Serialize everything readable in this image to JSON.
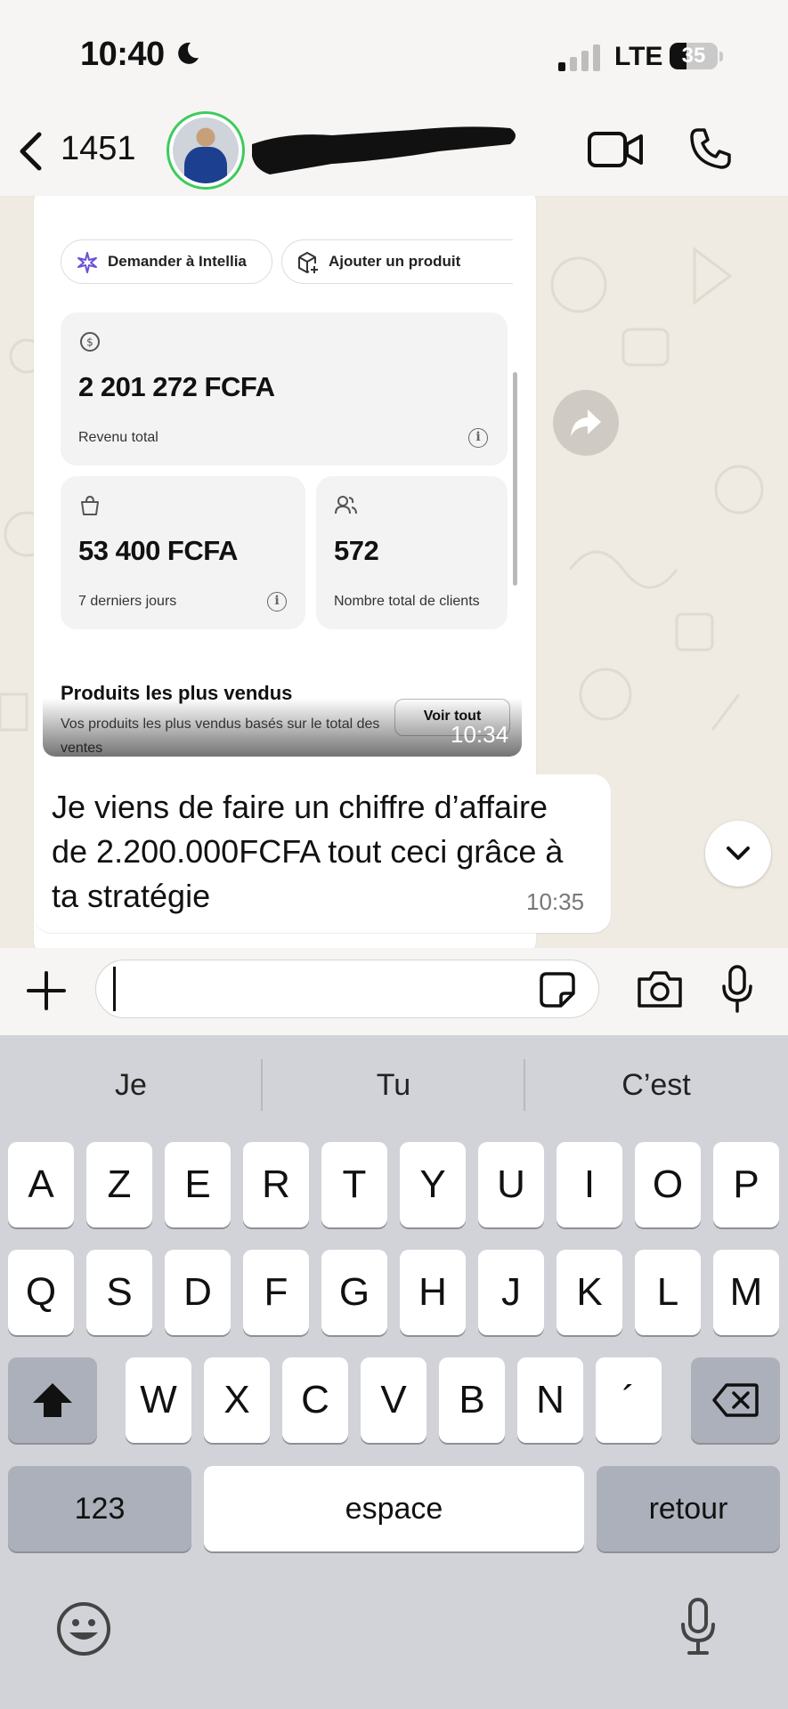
{
  "status": {
    "time": "10:40",
    "network": "LTE",
    "battery": "35",
    "battery_level": 0.35
  },
  "header": {
    "back_count": "1451"
  },
  "shared_screenshot": {
    "action_ask": "Demander à Intellia",
    "action_add": "Ajouter un produit",
    "total_revenue": {
      "value": "2 201 272 FCFA",
      "label": "Revenu total"
    },
    "last7": {
      "value": "53 400 FCFA",
      "label": "7 derniers jours"
    },
    "clients": {
      "value": "572",
      "label": "Nombre total de clients"
    },
    "products_title": "Produits les plus vendus",
    "products_subtitle": "Vos produits les plus vendus basés sur le total des ventes",
    "see_all": "Voir tout",
    "time": "10:34"
  },
  "message": {
    "text": "Je viens de faire un chiffre d’affaire de 2.200.000FCFA tout ceci grâce à ta stratégie",
    "time": "10:35"
  },
  "keyboard": {
    "suggestions": [
      "Je",
      "Tu",
      "C’est"
    ],
    "row1": [
      "A",
      "Z",
      "E",
      "R",
      "T",
      "Y",
      "U",
      "I",
      "O",
      "P"
    ],
    "row2": [
      "Q",
      "S",
      "D",
      "F",
      "G",
      "H",
      "J",
      "K",
      "L",
      "M"
    ],
    "row3": [
      "W",
      "X",
      "C",
      "V",
      "B",
      "N",
      "´"
    ],
    "numbers": "123",
    "space": "espace",
    "return": "retour"
  }
}
